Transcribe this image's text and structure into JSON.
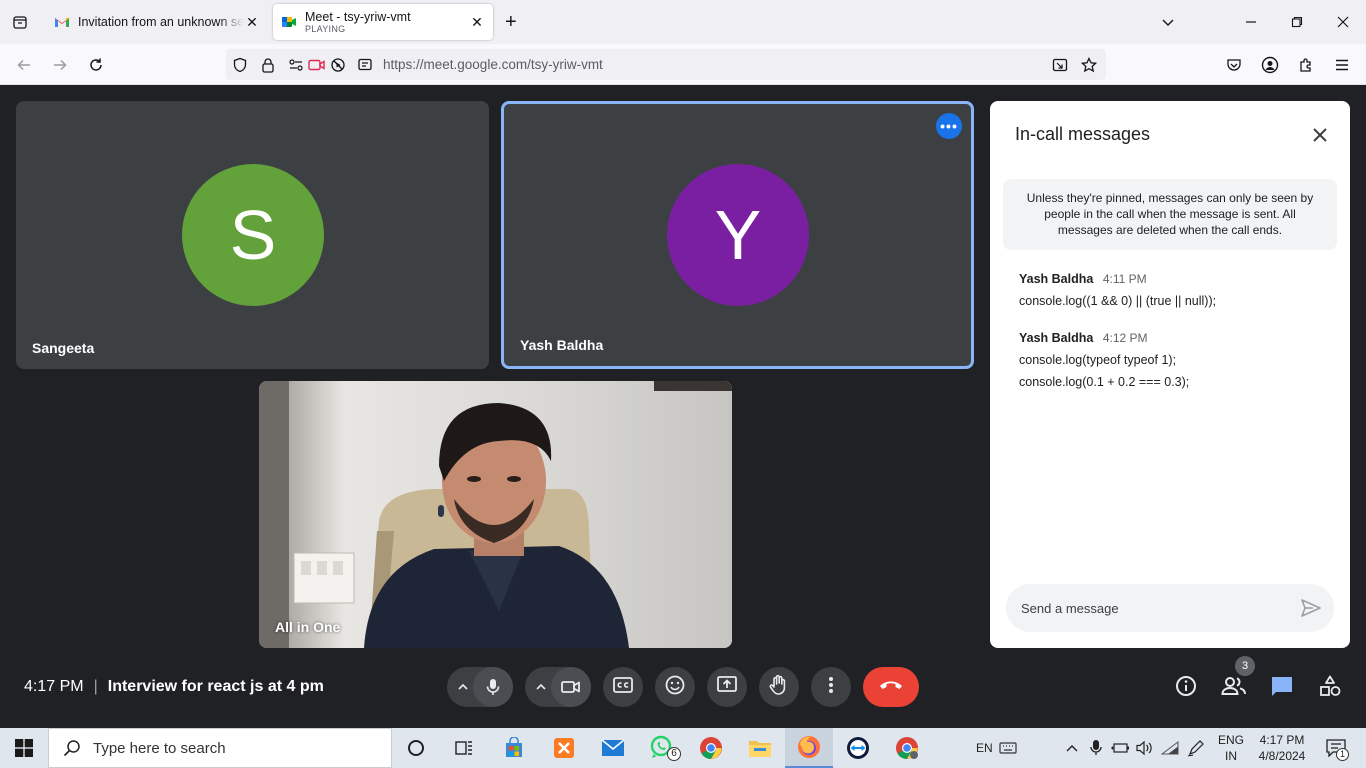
{
  "browser": {
    "tabs": [
      {
        "title": "Invitation from an unknown sender",
        "subtitle": ""
      },
      {
        "title": "Meet - tsy-yriw-vmt",
        "subtitle": "PLAYING"
      }
    ],
    "url": "https://meet.google.com/tsy-yriw-vmt"
  },
  "participants": [
    {
      "name": "Sangeeta",
      "initial": "S",
      "color": "#63a23a"
    },
    {
      "name": "Yash Baldha",
      "initial": "Y",
      "color": "#7b1fa2"
    }
  ],
  "self_view": {
    "name": "All in One"
  },
  "chat": {
    "title": "In-call messages",
    "notice": "Unless they're pinned, messages can only be seen by people in the call when the message is sent. All messages are deleted when the call ends.",
    "messages": [
      {
        "sender": "Yash Baldha",
        "time": "4:11 PM",
        "lines": [
          "console.log((1 && 0) || (true || null));"
        ]
      },
      {
        "sender": "Yash Baldha",
        "time": "4:12 PM",
        "lines": [
          "console.log(typeof typeof 1);",
          "console.log(0.1 + 0.2 === 0.3);"
        ]
      }
    ],
    "placeholder": "Send a message"
  },
  "meeting": {
    "time": "4:17 PM",
    "title": "Interview for react js at 4 pm",
    "people_count": "3"
  },
  "taskbar": {
    "search_placeholder": "Type here to search",
    "whatsapp_badge": "6",
    "lang_short": "EN",
    "lang_code": "ENG",
    "lang_region": "IN",
    "clock_time": "4:17 PM",
    "clock_date": "4/8/2024",
    "notification_count": "1"
  },
  "colors": {
    "background": "#202124",
    "tile": "#3c4043",
    "active_border": "#8ab4f8",
    "end_call": "#ea4335",
    "chat_accent": "#8ab4f8"
  }
}
